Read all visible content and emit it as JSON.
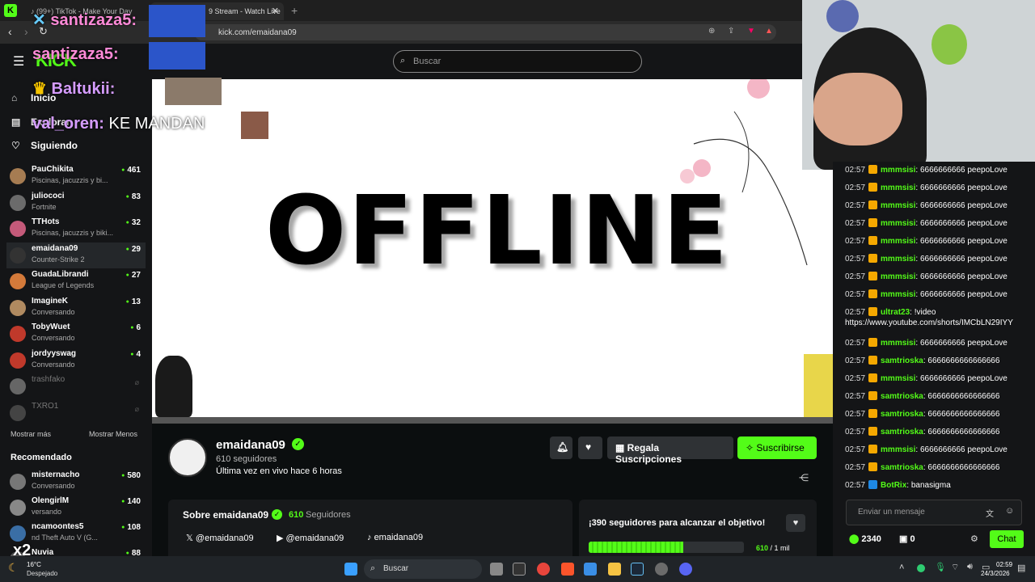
{
  "browser": {
    "tabs": [
      {
        "label": "(99+) TikTok - Make Your Day"
      },
      {
        "label": "9 Stream - Watch Live"
      }
    ],
    "url": "kick.com/emaidana09"
  },
  "header": {
    "search_placeholder": "Buscar"
  },
  "sidebar": {
    "nav": [
      {
        "label": "Inicio",
        "icon": "home-icon"
      },
      {
        "label": "Explorar",
        "icon": "explore-icon"
      },
      {
        "label": "Siguiendo",
        "icon": "heart-icon"
      }
    ],
    "following": [
      {
        "name": "PauChikita",
        "sub": "Piscinas, jacuzzis y bi...",
        "viewers": "461",
        "color": "#a67c52"
      },
      {
        "name": "juliococi",
        "sub": "Fortnite",
        "viewers": "83",
        "color": "#6b6b6b"
      },
      {
        "name": "TTHots",
        "sub": "Piscinas, jacuzzis y biki...",
        "viewers": "32",
        "color": "#c45a7a"
      },
      {
        "name": "emaidana09",
        "sub": "Counter-Strike 2",
        "viewers": "29",
        "color": "#333"
      },
      {
        "name": "GuadaLibrandi",
        "sub": "League of Legends",
        "viewers": "27",
        "color": "#d47a3a"
      },
      {
        "name": "ImagineK",
        "sub": "Conversando",
        "viewers": "13",
        "color": "#b08a60"
      },
      {
        "name": "TobyWuet",
        "sub": "Conversando",
        "viewers": "6",
        "color": "#c0392b"
      },
      {
        "name": "jordyyswag",
        "sub": "Conversando",
        "viewers": "4",
        "color": "#c0392b"
      },
      {
        "name": "trashfako",
        "sub": "",
        "viewers": "",
        "color": "#666"
      },
      {
        "name": "TXRO1",
        "sub": "",
        "viewers": "",
        "color": "#444"
      }
    ],
    "show_more": "Mostrar más",
    "show_less": "Mostrar Menos",
    "recommended_title": "Recomendado",
    "recommended": [
      {
        "name": "misternacho",
        "sub": "Conversando",
        "viewers": "580",
        "color": "#777"
      },
      {
        "name": "OlengirlM",
        "sub": "versando",
        "viewers": "140",
        "color": "#888"
      },
      {
        "name": "ncamoontes5",
        "sub": "nd Theft Auto V (G...",
        "viewers": "108",
        "color": "#3a6ea5"
      },
      {
        "name": "Nuvia",
        "sub": "",
        "viewers": "88",
        "color": "#5a5a5a"
      }
    ]
  },
  "overlay": {
    "lines": [
      {
        "user": "santizaza5:",
        "color": "#ff8ad8"
      },
      {
        "user": "santizaza5:",
        "color": "#ff8ad8"
      },
      {
        "user": "Baltukii:",
        "color": "#d59cff"
      },
      {
        "user": "val_oren:",
        "color": "#d59cff",
        "text": "KE MANDAN"
      }
    ],
    "x2": "x2"
  },
  "player": {
    "status": "OFFLINE"
  },
  "channel": {
    "name": "emaidana09",
    "followers": "610 seguidores",
    "last_live": "Última vez en vivo hace 6 horas",
    "gift_label": "Regala Suscripciones",
    "subscribe_label": "Suscribirse",
    "about_title": "Sobre emaidana09",
    "about_count": "610",
    "about_count_label": "Seguidores",
    "socials": [
      {
        "icon": "x-icon",
        "handle": "@emaidana09"
      },
      {
        "icon": "youtube-icon",
        "handle": "@emaidana09"
      },
      {
        "icon": "tiktok-icon",
        "handle": "emaidana09"
      }
    ],
    "goal_title": "¡390 seguidores para alcanzar el objetivo!",
    "goal_progress": 0.61,
    "goal_count": "610",
    "goal_target": "/ 1 mil"
  },
  "chat": {
    "messages": [
      {
        "time": "02:57",
        "user": "mmmsisi",
        "text": "6666666666 peepoLove",
        "color": "#53fc18",
        "badge": "#f5a800"
      },
      {
        "time": "02:57",
        "user": "mmmsisi",
        "text": "6666666666 peepoLove",
        "color": "#53fc18",
        "badge": "#f5a800"
      },
      {
        "time": "02:57",
        "user": "mmmsisi",
        "text": "6666666666 peepoLove",
        "color": "#53fc18",
        "badge": "#f5a800"
      },
      {
        "time": "02:57",
        "user": "mmmsisi",
        "text": "6666666666 peepoLove",
        "color": "#53fc18",
        "badge": "#f5a800"
      },
      {
        "time": "02:57",
        "user": "mmmsisi",
        "text": "6666666666 peepoLove",
        "color": "#53fc18",
        "badge": "#f5a800"
      },
      {
        "time": "02:57",
        "user": "mmmsisi",
        "text": "6666666666 peepoLove",
        "color": "#53fc18",
        "badge": "#f5a800"
      },
      {
        "time": "02:57",
        "user": "mmmsisi",
        "text": "6666666666 peepoLove",
        "color": "#53fc18",
        "badge": "#f5a800"
      },
      {
        "time": "02:57",
        "user": "mmmsisi",
        "text": "6666666666 peepoLove",
        "color": "#53fc18",
        "badge": "#f5a800"
      },
      {
        "time": "02:57",
        "user": "ultrat23",
        "text": "!video",
        "color": "#53fc18",
        "badge": "#f5a800"
      },
      {
        "time": "",
        "user": "",
        "text": "https://www.youtube.com/shorts/IMCbLN29IYY",
        "color": "#fff",
        "badge": ""
      },
      {
        "time": "02:57",
        "user": "mmmsisi",
        "text": "6666666666 peepoLove",
        "color": "#53fc18",
        "badge": "#f5a800"
      },
      {
        "time": "02:57",
        "user": "samtrioska",
        "text": "6666666666666666",
        "color": "#53fc18",
        "badge": "#f5a800"
      },
      {
        "time": "02:57",
        "user": "mmmsisi",
        "text": "6666666666 peepoLove",
        "color": "#53fc18",
        "badge": "#f5a800"
      },
      {
        "time": "02:57",
        "user": "samtrioska",
        "text": "6666666666666666",
        "color": "#53fc18",
        "badge": "#f5a800"
      },
      {
        "time": "02:57",
        "user": "samtrioska",
        "text": "6666666666666666",
        "color": "#53fc18",
        "badge": "#f5a800"
      },
      {
        "time": "02:57",
        "user": "samtrioska",
        "text": "6666666666666666",
        "color": "#53fc18",
        "badge": "#f5a800"
      },
      {
        "time": "02:57",
        "user": "mmmsisi",
        "text": "6666666666 peepoLove",
        "color": "#53fc18",
        "badge": "#f5a800"
      },
      {
        "time": "02:57",
        "user": "samtrioska",
        "text": "6666666666666666",
        "color": "#53fc18",
        "badge": "#f5a800"
      },
      {
        "time": "02:57",
        "user": "BotRix",
        "text": "banasigma",
        "color": "#53fc18",
        "badge": "#1e88e5"
      }
    ],
    "input_placeholder": "Enviar un mensaje",
    "points": "2340",
    "zero": "0",
    "chat_button": "Chat"
  },
  "taskbar": {
    "weather_temp": "16°C",
    "weather_desc": "Despejado",
    "search_placeholder": "Buscar",
    "time": "02:59",
    "date": "24/3/2026"
  },
  "colors": {
    "accent": "#53fc18",
    "bg": "#0b0e0f",
    "panel": "#141517"
  }
}
